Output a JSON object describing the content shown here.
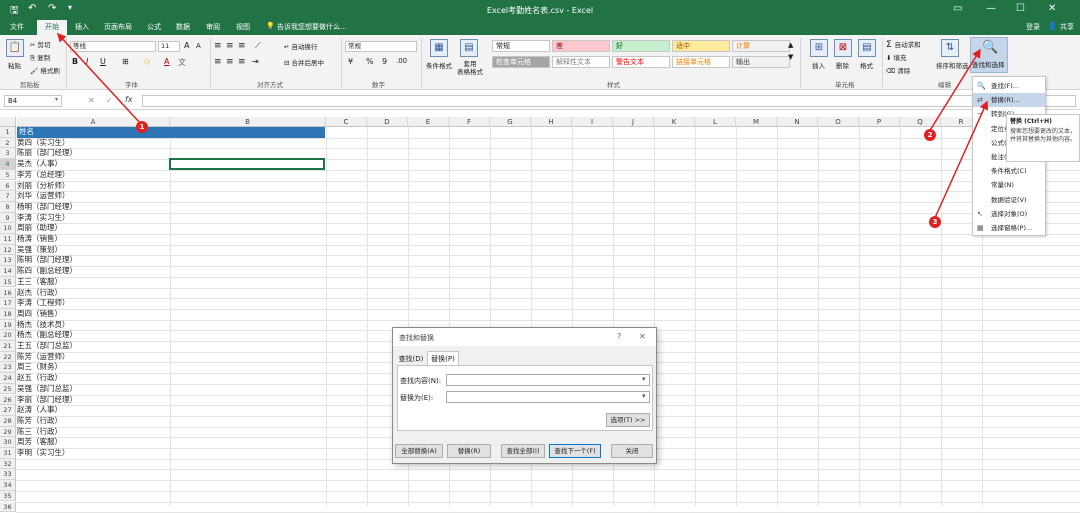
{
  "title": "Excel考勤姓名表.csv - Excel",
  "titlebar": {
    "save_icon": "save-icon",
    "undo_icon": "undo-icon",
    "redo_icon": "redo-icon",
    "qat_more": "customize-quick-access-icon"
  },
  "tabs": [
    "文件",
    "开始",
    "插入",
    "页面布局",
    "公式",
    "数据",
    "审阅",
    "视图"
  ],
  "tell_me": "告诉我您想要做什么...",
  "login": "登录",
  "share": "共享",
  "ribbon": {
    "clipboard": {
      "paste": "粘贴",
      "cut": "剪切",
      "copy": "复制",
      "format_painter": "格式刷",
      "label": "剪贴板"
    },
    "font": {
      "name": "等线",
      "size": "11",
      "label": "字体",
      "bold": "B",
      "italic": "I",
      "underline": "U",
      "grow": "A",
      "shrink": "A",
      "font_color": "A",
      "fill_color": "◇"
    },
    "align": {
      "wrap": "自动换行",
      "merge": "合并后居中",
      "label": "对齐方式"
    },
    "number": {
      "format": "常规",
      "percent": "%",
      "comma": "9",
      "label": "数字"
    },
    "styles": {
      "conditional": "条件格式",
      "table": "套用\n表格格式",
      "label": "样式",
      "cells": [
        {
          "text": "常规",
          "bg": "#ffffff",
          "fg": "#222222"
        },
        {
          "text": "差",
          "bg": "#ffc7ce",
          "fg": "#9c0006"
        },
        {
          "text": "好",
          "bg": "#c6efce",
          "fg": "#006100"
        },
        {
          "text": "适中",
          "bg": "#ffeb9c",
          "fg": "#9c5700"
        },
        {
          "text": "计算",
          "bg": "#f2f2f2",
          "fg": "#fa7d00"
        },
        {
          "text": "检查单元格",
          "bg": "#a5a5a5",
          "fg": "#ffffff"
        },
        {
          "text": "解释性文本",
          "bg": "#ffffff",
          "fg": "#7f7f7f"
        },
        {
          "text": "警告文本",
          "bg": "#ffffff",
          "fg": "#ff0000"
        },
        {
          "text": "链接单元格",
          "bg": "#ffffff",
          "fg": "#fa7d00"
        },
        {
          "text": "输出",
          "bg": "#f2f2f2",
          "fg": "#3f3f3f"
        }
      ]
    },
    "cells": {
      "insert": "插入",
      "delete": "删除",
      "format": "格式",
      "label": "单元格"
    },
    "editing": {
      "autosum": "自动求和",
      "fill": "填充",
      "clear": "清除",
      "sort": "排序和筛选",
      "find": "查找和选择",
      "label": "编辑"
    }
  },
  "formula_bar": {
    "name_box": "B4",
    "fx": "fx",
    "value": ""
  },
  "columns": [
    "A",
    "B",
    "C",
    "D",
    "E",
    "F",
    "G",
    "H",
    "I",
    "J",
    "K",
    "L",
    "M",
    "N",
    "O",
    "P",
    "Q",
    "R"
  ],
  "rows": [
    "姓名",
    "黄四（实习生）",
    "陈丽（部门经理）",
    "吴杰（人事）",
    "李芳（总经理）",
    "刘丽（分析师）",
    "刘华（运营师）",
    "杨明（部门经理）",
    "李涛（实习生）",
    "周丽（助理）",
    "杨涛（销售）",
    "吴强（策划）",
    "陈明（部门经理）",
    "陈四（副总经理）",
    "王三（客服）",
    "赵杰（行政）",
    "李涛（工程师）",
    "周四（销售）",
    "杨杰（技术员）",
    "杨杰（副总经理）",
    "王五（部门总监）",
    "陈芳（运营师）",
    "周三（财务）",
    "赵五（行政）",
    "吴强（部门总监）",
    "李丽（部门经理）",
    "赵涛（人事）",
    "陈芳（行政）",
    "陈三（行政）",
    "周芳（客服）",
    "李明（实习生）",
    "",
    "",
    "",
    "",
    ""
  ],
  "menu": {
    "items": [
      {
        "label": "查找(F)...",
        "icon": "search-icon"
      },
      {
        "label": "替换(R)...",
        "icon": "replace-icon"
      },
      {
        "label": "转到(G)...",
        "icon": "goto-icon"
      },
      {
        "label": "定位条件(S)...",
        "icon": ""
      },
      {
        "label": "公式(U)",
        "icon": ""
      },
      {
        "label": "批注(M)",
        "icon": ""
      },
      {
        "label": "条件格式(C)",
        "icon": ""
      },
      {
        "label": "常量(N)",
        "icon": ""
      },
      {
        "label": "数据验证(V)",
        "icon": ""
      },
      {
        "label": "选择对象(O)",
        "icon": "pointer-icon"
      },
      {
        "label": "选择窗格(P)...",
        "icon": "pane-icon"
      }
    ]
  },
  "tooltip": {
    "title": "替换 (Ctrl+H)",
    "body": "搜索您想要更改的文本，并将其替换为其他内容。"
  },
  "dialog": {
    "title": "查找和替换",
    "help": "?",
    "close_x": "✕",
    "tab_find": "查找(D)",
    "tab_replace": "替换(P)",
    "find_label": "查找内容(N):",
    "replace_label": "替换为(E):",
    "options": "选项(T) >>",
    "replace_all": "全部替换(A)",
    "replace": "替换(R)",
    "find_all": "查找全部(I)",
    "find_next": "查找下一个(F)",
    "close": "关闭"
  },
  "markers": [
    "1",
    "2",
    "3"
  ]
}
